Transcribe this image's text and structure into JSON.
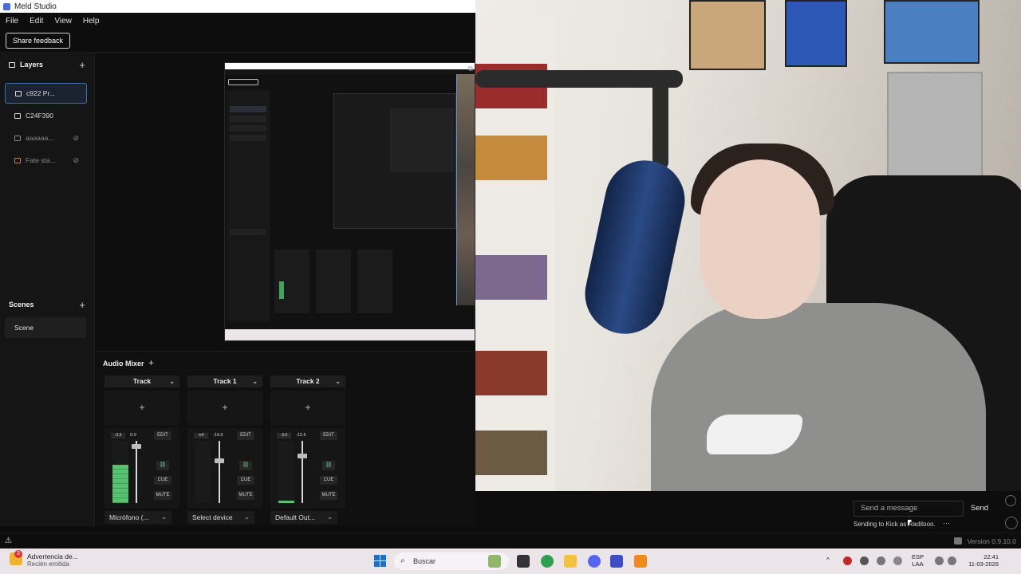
{
  "window": {
    "title": "Meld Studio"
  },
  "menu": [
    "File",
    "Edit",
    "View",
    "Help"
  ],
  "toolbar": {
    "share_label": "Share feedback"
  },
  "layers": {
    "title": "Layers",
    "items": [
      {
        "label": "c922 Pr...",
        "icon": "camera-icon",
        "selected": true
      },
      {
        "label": "C24F390",
        "icon": "monitor-icon",
        "selected": false
      },
      {
        "label": "aaaaaa...",
        "icon": "image-icon",
        "selected": false
      },
      {
        "label": "Fate sta...",
        "icon": "image-icon",
        "selected": false
      }
    ]
  },
  "scenes": {
    "title": "Scenes",
    "items": [
      "Scene"
    ]
  },
  "audio_mixer": {
    "title": "Audio Mixer",
    "tracks": [
      {
        "name": "Track",
        "meter": "-3.3",
        "fader": "0.0",
        "level": 0.62,
        "fader_pos": 0.05,
        "device": "Micrófono (..."
      },
      {
        "name": "Track 1",
        "meter": "-inf",
        "fader": "-10.0",
        "level": 0.0,
        "fader_pos": 0.3,
        "device": "Select device"
      },
      {
        "name": "Track 2",
        "meter": "-3.0",
        "fader": "-12.5",
        "level": 0.04,
        "fader_pos": 0.22,
        "device": "Default Out..."
      }
    ],
    "buttons": {
      "edit": "EDIT",
      "cue": "CUE",
      "mute": "MUTE"
    }
  },
  "chat": {
    "placeholder": "Send a message",
    "send": "Send",
    "status": "Sending to Kick as Raditooo."
  },
  "status": {
    "version": "Version 0.9.10.0"
  },
  "taskbar": {
    "notification_title": "Advertencia de...",
    "notification_sub": "Recién emitida",
    "notification_badge": "3",
    "search": "Buscar",
    "lang1": "ESP",
    "lang2": "LAA",
    "time": "22:41",
    "date": "11-03-2026"
  },
  "colors": {
    "accent": "#3d6fb3",
    "meter_green": "#58c16f"
  }
}
